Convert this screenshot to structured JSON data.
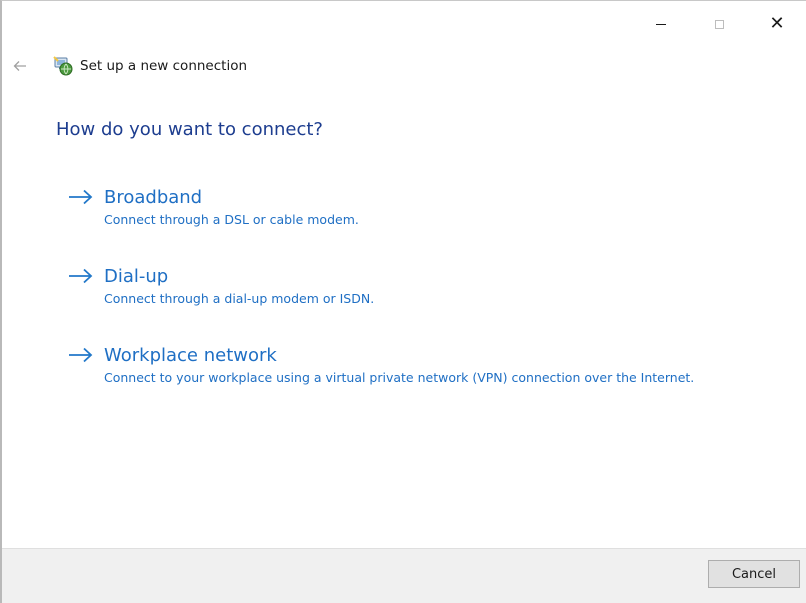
{
  "window": {
    "caption": {
      "minimize_icon": "minimize-icon",
      "maximize_icon": "maximize-icon",
      "close_icon": "close-icon",
      "close_glyph": "✕"
    }
  },
  "header": {
    "back_icon": "back-arrow-icon",
    "app_icon": "network-connection-icon",
    "title": "Set up a new connection"
  },
  "main": {
    "question": "How do you want to connect?",
    "options": [
      {
        "title": "Broadband",
        "description": "Connect through a DSL or cable modem.",
        "icon": "arrow-right-icon"
      },
      {
        "title": "Dial-up",
        "description": "Connect through a dial-up modem or ISDN.",
        "icon": "arrow-right-icon"
      },
      {
        "title": "Workplace network",
        "description": "Connect to your workplace using a virtual private network (VPN) connection over the Internet.",
        "icon": "arrow-right-icon"
      }
    ]
  },
  "footer": {
    "cancel_label": "Cancel"
  },
  "colors": {
    "accent_blue": "#1f6fc4",
    "heading_blue": "#1d3d8f",
    "footer_bg": "#f0f0f0"
  }
}
